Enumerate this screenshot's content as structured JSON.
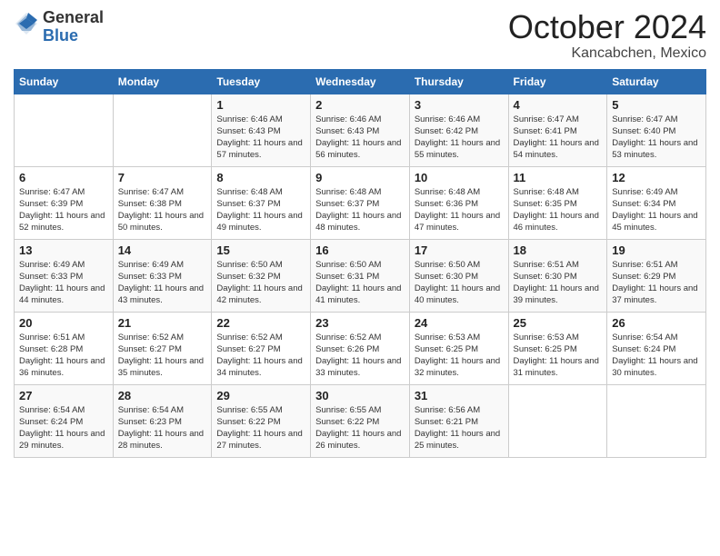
{
  "header": {
    "logo_general": "General",
    "logo_blue": "Blue",
    "month": "October 2024",
    "location": "Kancabchen, Mexico"
  },
  "days_of_week": [
    "Sunday",
    "Monday",
    "Tuesday",
    "Wednesday",
    "Thursday",
    "Friday",
    "Saturday"
  ],
  "weeks": [
    [
      {
        "day": "",
        "info": ""
      },
      {
        "day": "",
        "info": ""
      },
      {
        "day": "1",
        "info": "Sunrise: 6:46 AM\nSunset: 6:43 PM\nDaylight: 11 hours and 57 minutes."
      },
      {
        "day": "2",
        "info": "Sunrise: 6:46 AM\nSunset: 6:43 PM\nDaylight: 11 hours and 56 minutes."
      },
      {
        "day": "3",
        "info": "Sunrise: 6:46 AM\nSunset: 6:42 PM\nDaylight: 11 hours and 55 minutes."
      },
      {
        "day": "4",
        "info": "Sunrise: 6:47 AM\nSunset: 6:41 PM\nDaylight: 11 hours and 54 minutes."
      },
      {
        "day": "5",
        "info": "Sunrise: 6:47 AM\nSunset: 6:40 PM\nDaylight: 11 hours and 53 minutes."
      }
    ],
    [
      {
        "day": "6",
        "info": "Sunrise: 6:47 AM\nSunset: 6:39 PM\nDaylight: 11 hours and 52 minutes."
      },
      {
        "day": "7",
        "info": "Sunrise: 6:47 AM\nSunset: 6:38 PM\nDaylight: 11 hours and 50 minutes."
      },
      {
        "day": "8",
        "info": "Sunrise: 6:48 AM\nSunset: 6:37 PM\nDaylight: 11 hours and 49 minutes."
      },
      {
        "day": "9",
        "info": "Sunrise: 6:48 AM\nSunset: 6:37 PM\nDaylight: 11 hours and 48 minutes."
      },
      {
        "day": "10",
        "info": "Sunrise: 6:48 AM\nSunset: 6:36 PM\nDaylight: 11 hours and 47 minutes."
      },
      {
        "day": "11",
        "info": "Sunrise: 6:48 AM\nSunset: 6:35 PM\nDaylight: 11 hours and 46 minutes."
      },
      {
        "day": "12",
        "info": "Sunrise: 6:49 AM\nSunset: 6:34 PM\nDaylight: 11 hours and 45 minutes."
      }
    ],
    [
      {
        "day": "13",
        "info": "Sunrise: 6:49 AM\nSunset: 6:33 PM\nDaylight: 11 hours and 44 minutes."
      },
      {
        "day": "14",
        "info": "Sunrise: 6:49 AM\nSunset: 6:33 PM\nDaylight: 11 hours and 43 minutes."
      },
      {
        "day": "15",
        "info": "Sunrise: 6:50 AM\nSunset: 6:32 PM\nDaylight: 11 hours and 42 minutes."
      },
      {
        "day": "16",
        "info": "Sunrise: 6:50 AM\nSunset: 6:31 PM\nDaylight: 11 hours and 41 minutes."
      },
      {
        "day": "17",
        "info": "Sunrise: 6:50 AM\nSunset: 6:30 PM\nDaylight: 11 hours and 40 minutes."
      },
      {
        "day": "18",
        "info": "Sunrise: 6:51 AM\nSunset: 6:30 PM\nDaylight: 11 hours and 39 minutes."
      },
      {
        "day": "19",
        "info": "Sunrise: 6:51 AM\nSunset: 6:29 PM\nDaylight: 11 hours and 37 minutes."
      }
    ],
    [
      {
        "day": "20",
        "info": "Sunrise: 6:51 AM\nSunset: 6:28 PM\nDaylight: 11 hours and 36 minutes."
      },
      {
        "day": "21",
        "info": "Sunrise: 6:52 AM\nSunset: 6:27 PM\nDaylight: 11 hours and 35 minutes."
      },
      {
        "day": "22",
        "info": "Sunrise: 6:52 AM\nSunset: 6:27 PM\nDaylight: 11 hours and 34 minutes."
      },
      {
        "day": "23",
        "info": "Sunrise: 6:52 AM\nSunset: 6:26 PM\nDaylight: 11 hours and 33 minutes."
      },
      {
        "day": "24",
        "info": "Sunrise: 6:53 AM\nSunset: 6:25 PM\nDaylight: 11 hours and 32 minutes."
      },
      {
        "day": "25",
        "info": "Sunrise: 6:53 AM\nSunset: 6:25 PM\nDaylight: 11 hours and 31 minutes."
      },
      {
        "day": "26",
        "info": "Sunrise: 6:54 AM\nSunset: 6:24 PM\nDaylight: 11 hours and 30 minutes."
      }
    ],
    [
      {
        "day": "27",
        "info": "Sunrise: 6:54 AM\nSunset: 6:24 PM\nDaylight: 11 hours and 29 minutes."
      },
      {
        "day": "28",
        "info": "Sunrise: 6:54 AM\nSunset: 6:23 PM\nDaylight: 11 hours and 28 minutes."
      },
      {
        "day": "29",
        "info": "Sunrise: 6:55 AM\nSunset: 6:22 PM\nDaylight: 11 hours and 27 minutes."
      },
      {
        "day": "30",
        "info": "Sunrise: 6:55 AM\nSunset: 6:22 PM\nDaylight: 11 hours and 26 minutes."
      },
      {
        "day": "31",
        "info": "Sunrise: 6:56 AM\nSunset: 6:21 PM\nDaylight: 11 hours and 25 minutes."
      },
      {
        "day": "",
        "info": ""
      },
      {
        "day": "",
        "info": ""
      }
    ]
  ]
}
